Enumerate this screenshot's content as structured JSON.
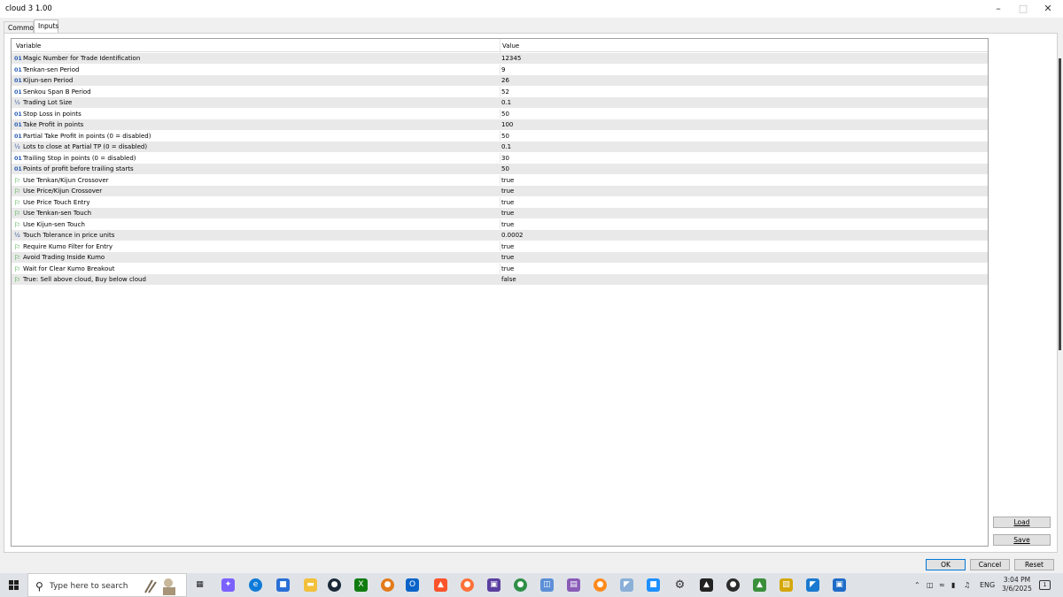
{
  "window": {
    "title": "cloud 3 1.00"
  },
  "tabs": [
    {
      "label": "Common"
    },
    {
      "label": "Inputs"
    }
  ],
  "table": {
    "headers": {
      "variable": "Variable",
      "value": "Value"
    },
    "rows": [
      {
        "type": "int",
        "icon": "01",
        "name": "Magic Number for Trade Identification",
        "value": "12345"
      },
      {
        "type": "int",
        "icon": "01",
        "name": "Tenkan-sen Period",
        "value": "9"
      },
      {
        "type": "int",
        "icon": "01",
        "name": "Kijun-sen Period",
        "value": "26"
      },
      {
        "type": "int",
        "icon": "01",
        "name": "Senkou Span B Period",
        "value": "52"
      },
      {
        "type": "double",
        "icon": "½",
        "name": "Trading Lot Size",
        "value": "0.1"
      },
      {
        "type": "int",
        "icon": "01",
        "name": "Stop Loss in points",
        "value": "50"
      },
      {
        "type": "int",
        "icon": "01",
        "name": "Take Profit in points",
        "value": "100"
      },
      {
        "type": "int",
        "icon": "01",
        "name": "Partial Take Profit in points (0 = disabled)",
        "value": "50"
      },
      {
        "type": "double",
        "icon": "½",
        "name": "Lots to close at Partial TP (0 = disabled)",
        "value": "0.1"
      },
      {
        "type": "int",
        "icon": "01",
        "name": "Trailing Stop in points (0 = disabled)",
        "value": "30"
      },
      {
        "type": "int",
        "icon": "01",
        "name": "Points of profit before trailing starts",
        "value": "50"
      },
      {
        "type": "bool",
        "icon": "⚐",
        "name": "Use Tenkan/Kijun Crossover",
        "value": "true"
      },
      {
        "type": "bool",
        "icon": "⚐",
        "name": "Use Price/Kijun Crossover",
        "value": "true"
      },
      {
        "type": "bool",
        "icon": "⚐",
        "name": "Use Price Touch Entry",
        "value": "true"
      },
      {
        "type": "bool",
        "icon": "⚐",
        "name": "Use Tenkan-sen Touch",
        "value": "true"
      },
      {
        "type": "bool",
        "icon": "⚐",
        "name": "Use Kijun-sen Touch",
        "value": "true"
      },
      {
        "type": "double",
        "icon": "½",
        "name": "Touch Tolerance in price units",
        "value": "0.0002"
      },
      {
        "type": "bool",
        "icon": "⚐",
        "name": "Require Kumo Filter for Entry",
        "value": "true"
      },
      {
        "type": "bool",
        "icon": "⚐",
        "name": "Avoid Trading Inside Kumo",
        "value": "true"
      },
      {
        "type": "bool",
        "icon": "⚐",
        "name": "Wait for Clear Kumo Breakout",
        "value": "true"
      },
      {
        "type": "bool",
        "icon": "⚐",
        "name": "True: Sell above cloud, Buy below cloud",
        "value": "false"
      }
    ]
  },
  "buttons": {
    "load": "Load",
    "save": "Save",
    "ok": "OK",
    "cancel": "Cancel",
    "reset": "Reset"
  },
  "taskbar": {
    "search_placeholder": "Type here to search",
    "language": "ENG",
    "time": "3:04 PM",
    "date": "3/6/2025",
    "notification_count": "1"
  }
}
